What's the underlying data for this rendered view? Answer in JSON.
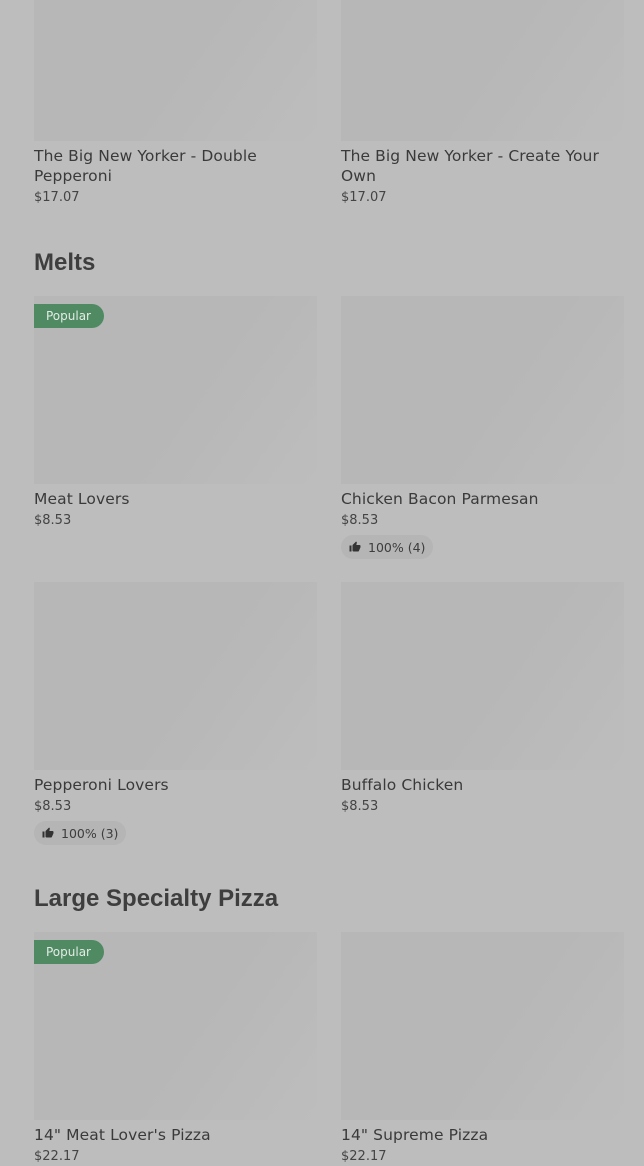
{
  "sections": {
    "top": {
      "items": [
        {
          "name": "The Big New Yorker - Double Pepperoni",
          "price": "$17.07"
        },
        {
          "name": "The Big New Yorker - Create Your Own",
          "price": "$17.07"
        }
      ]
    },
    "melts": {
      "title": "Melts",
      "items": [
        {
          "name": "Meat Lovers",
          "price": "$8.53",
          "badge": "Popular"
        },
        {
          "name": "Chicken Bacon Parmesan",
          "price": "$8.53",
          "rating": "100% (4)"
        },
        {
          "name": "Pepperoni Lovers",
          "price": "$8.53",
          "rating": "100% (3)"
        },
        {
          "name": "Buffalo Chicken",
          "price": "$8.53"
        }
      ]
    },
    "large_specialty": {
      "title": "Large Specialty Pizza",
      "items": [
        {
          "name": "14\" Meat Lover's Pizza",
          "price": "$22.17",
          "badge": "Popular"
        },
        {
          "name": "14\" Supreme Pizza",
          "price": "$22.17"
        }
      ]
    }
  },
  "icons": {
    "rating": "thumbs-up-icon"
  },
  "colors": {
    "background": "#bdbdbd",
    "popular_badge": "#4f8a62",
    "image_placeholder": "#b7b7b7"
  }
}
